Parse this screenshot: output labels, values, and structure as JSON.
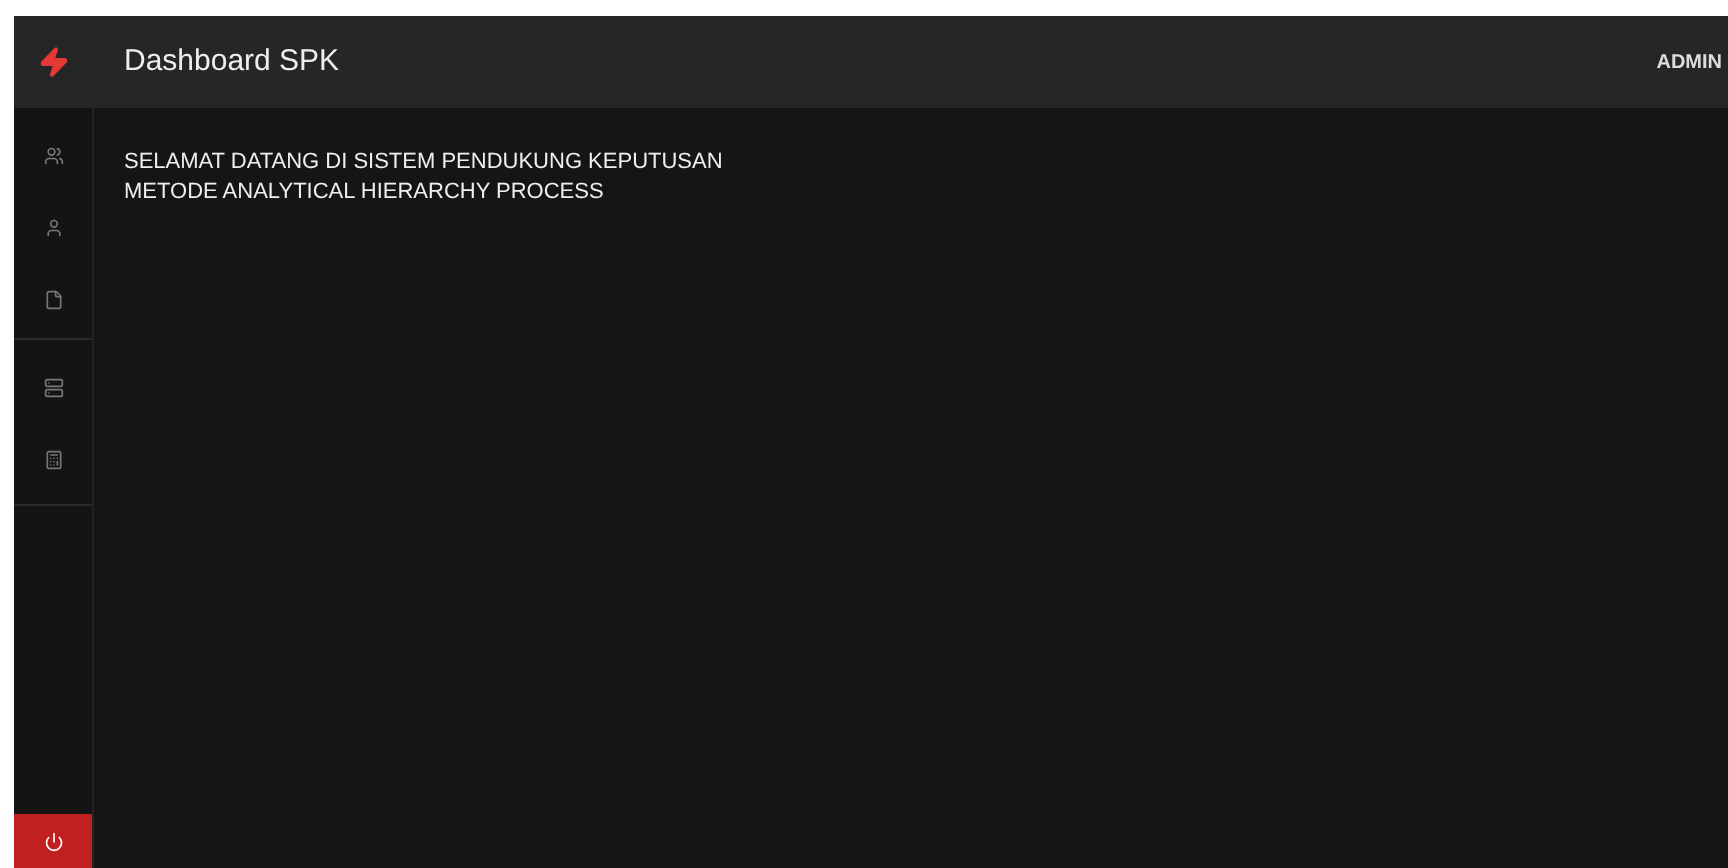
{
  "header": {
    "title": "Dashboard SPK",
    "user": "ADMIN"
  },
  "content": {
    "lines": [
      "SELAMAT DATANG DI SISTEM PENDUKUNG KEPUTUSAN",
      "METODE ANALYTICAL HIERARCHY PROCESS"
    ]
  },
  "sidebar": {
    "groups": [
      [
        {
          "kind": "users"
        },
        {
          "kind": "person"
        },
        {
          "kind": "file"
        }
      ],
      [
        {
          "kind": "server"
        },
        {
          "kind": "calculator"
        }
      ]
    ]
  }
}
